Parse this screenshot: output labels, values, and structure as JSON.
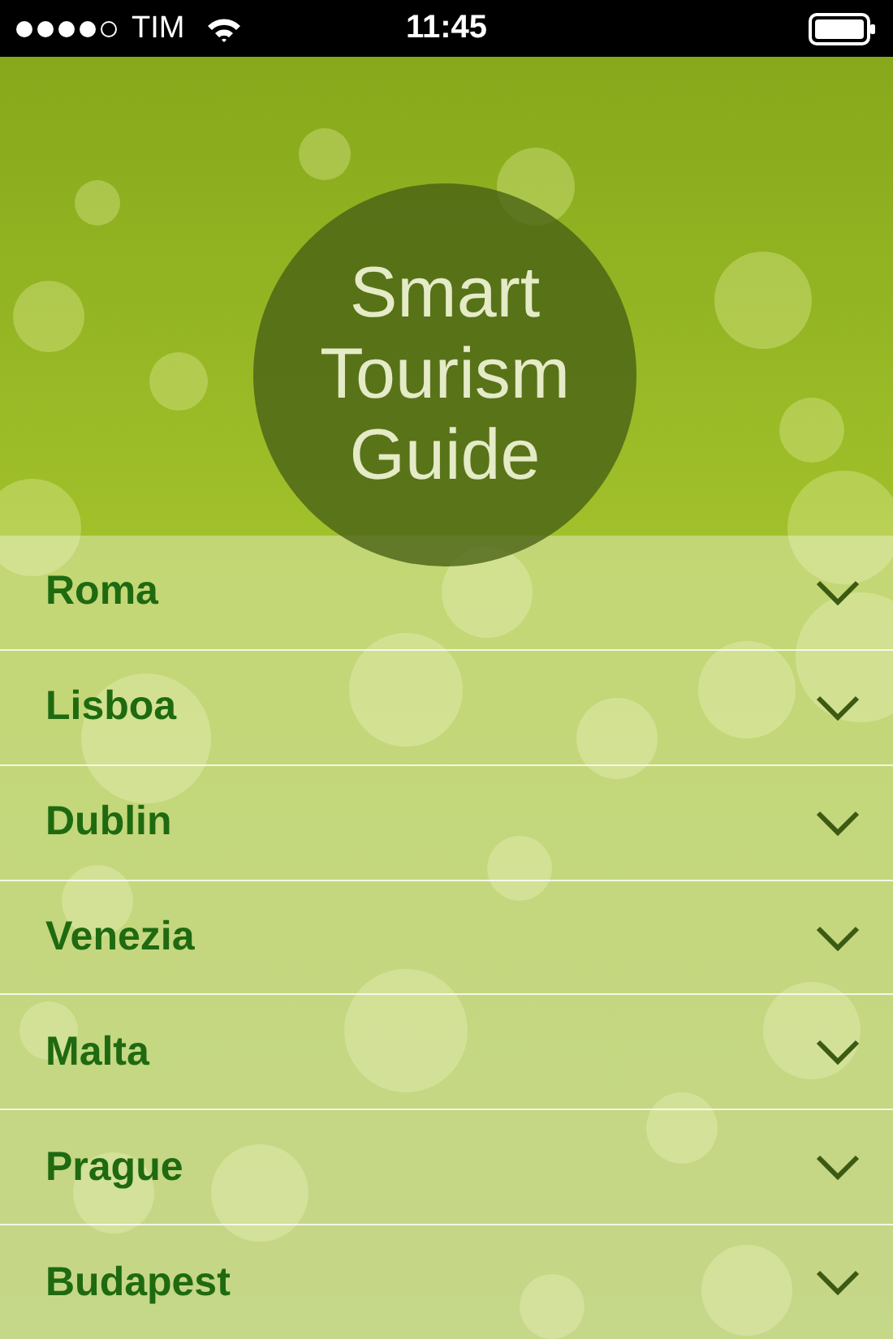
{
  "status_bar": {
    "carrier": "TIM",
    "time": "11:45",
    "signal_dots": [
      {
        "on": true
      },
      {
        "on": true
      },
      {
        "on": true
      },
      {
        "on": true
      },
      {
        "on": false
      }
    ]
  },
  "header": {
    "title_lines": [
      "Smart",
      "Tourism",
      "Guide"
    ]
  },
  "cities": [
    {
      "name": "Roma"
    },
    {
      "name": "Lisboa"
    },
    {
      "name": "Dublin"
    },
    {
      "name": "Venezia"
    },
    {
      "name": "Malta"
    },
    {
      "name": "Prague"
    },
    {
      "name": "Budapest"
    }
  ]
}
